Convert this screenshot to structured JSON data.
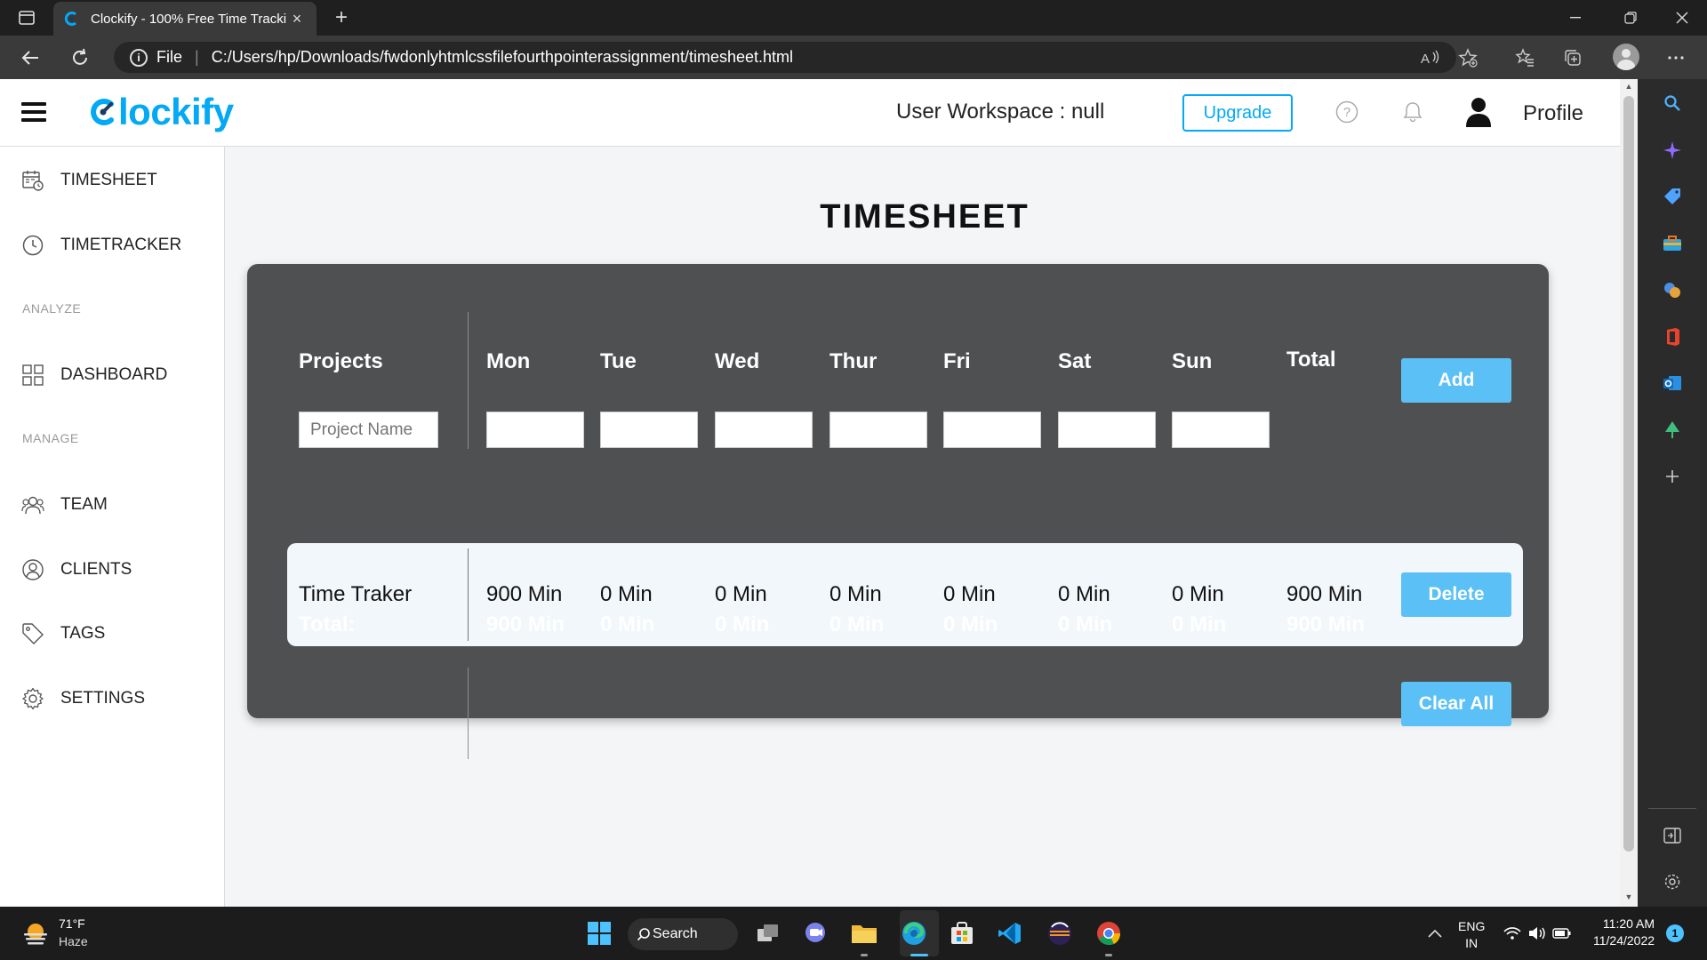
{
  "browser": {
    "tab_title": "Clockify - 100% Free Time Tracki",
    "tab_close": "×",
    "new_tab": "+",
    "address_scheme": "File",
    "address_path": "C:/Users/hp/Downloads/fwdonlyhtmlcssfilefourthpointerassignment/timesheet.html",
    "accent": "#03a9f4"
  },
  "app": {
    "logo_text": "lockify",
    "workspace_label": "User Workspace : null",
    "upgrade_label": "Upgrade",
    "profile_label": "Profile"
  },
  "sidebar": {
    "items": [
      {
        "label": "TIMESHEET",
        "icon": "calendar-clock-icon"
      },
      {
        "label": "TIMETRACKER",
        "icon": "clock-icon"
      },
      {
        "label": "DASHBOARD",
        "icon": "grid-icon"
      },
      {
        "label": "TEAM",
        "icon": "users-icon"
      },
      {
        "label": "CLIENTS",
        "icon": "user-circle-icon"
      },
      {
        "label": "TAGS",
        "icon": "tag-icon"
      },
      {
        "label": "SETTINGS",
        "icon": "gear-icon"
      }
    ],
    "sections": [
      "ANALYZE",
      "MANAGE"
    ]
  },
  "timesheet": {
    "title": "TIMESHEET",
    "headers": [
      "Projects",
      "Mon",
      "Tue",
      "Wed",
      "Thur",
      "Fri",
      "Sat",
      "Sun",
      "Total"
    ],
    "project_placeholder": "Project Name",
    "add_label": "Add",
    "rows": [
      {
        "project": "Time Traker",
        "values": [
          "900 Min",
          "0 Min",
          "0 Min",
          "0 Min",
          "0 Min",
          "0 Min",
          "0 Min"
        ],
        "total": "900 Min",
        "action": "Delete"
      }
    ],
    "totals_label": "Total:",
    "totals": [
      "900 Min",
      "0 Min",
      "0 Min",
      "0 Min",
      "0 Min",
      "0 Min",
      "0 Min"
    ],
    "grand_total": "900 Min",
    "clear_label": "Clear All"
  },
  "taskbar": {
    "weather_temp": "71°F",
    "weather_desc": "Haze",
    "search_label": "Search",
    "lang_top": "ENG",
    "lang_bottom": "IN",
    "time": "11:20 AM",
    "date": "11/24/2022",
    "notifications": "1"
  }
}
